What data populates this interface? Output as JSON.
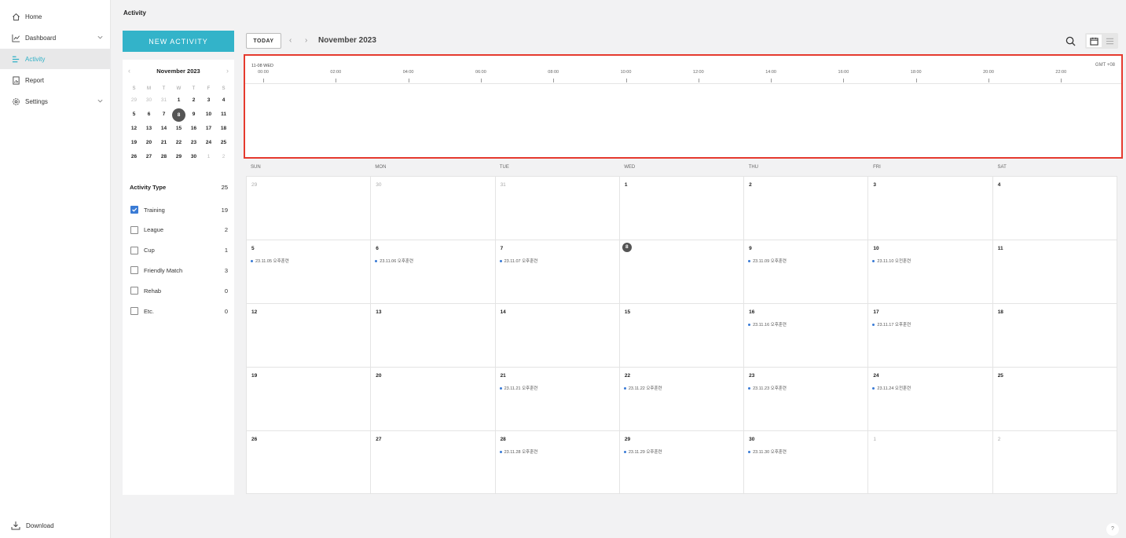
{
  "sidebar": {
    "items": [
      {
        "label": "Home"
      },
      {
        "label": "Dashboard"
      },
      {
        "label": "Activity"
      },
      {
        "label": "Report"
      },
      {
        "label": "Settings"
      }
    ],
    "download": "Download"
  },
  "header": {
    "title": "Activity"
  },
  "left_panel": {
    "new_button": "NEW ACTIVITY",
    "mini_calendar": {
      "title": "November 2023",
      "dow": [
        "S",
        "M",
        "T",
        "W",
        "T",
        "F",
        "S"
      ],
      "weeks": [
        [
          "29",
          "30",
          "31",
          "1",
          "2",
          "3",
          "4"
        ],
        [
          "5",
          "6",
          "7",
          "8",
          "9",
          "10",
          "11"
        ],
        [
          "12",
          "13",
          "14",
          "15",
          "16",
          "17",
          "18"
        ],
        [
          "19",
          "20",
          "21",
          "22",
          "23",
          "24",
          "25"
        ],
        [
          "26",
          "27",
          "28",
          "29",
          "30",
          "1",
          "2"
        ]
      ]
    },
    "activity_type": {
      "label": "Activity Type",
      "count": "25",
      "items": [
        {
          "label": "Training",
          "count": "19",
          "checked": true
        },
        {
          "label": "League",
          "count": "2",
          "checked": false
        },
        {
          "label": "Cup",
          "count": "1",
          "checked": false
        },
        {
          "label": "Friendly Match",
          "count": "3",
          "checked": false
        },
        {
          "label": "Rehab",
          "count": "0",
          "checked": false
        },
        {
          "label": "Etc.",
          "count": "0",
          "checked": false
        }
      ]
    }
  },
  "toolbar": {
    "today": "TODAY",
    "month_title": "November 2023"
  },
  "timeline": {
    "date_label": "11-08 WED",
    "timezone": "GMT +08",
    "hours": [
      "00:00",
      "02:00",
      "04:00",
      "06:00",
      "08:00",
      "10:00",
      "12:00",
      "14:00",
      "16:00",
      "18:00",
      "20:00",
      "22:00"
    ]
  },
  "month": {
    "dow": [
      "SUN",
      "MON",
      "TUE",
      "WED",
      "THU",
      "FRI",
      "SAT"
    ],
    "weeks": [
      [
        {
          "d": "29"
        },
        {
          "d": "30"
        },
        {
          "d": "31"
        },
        {
          "d": "1"
        },
        {
          "d": "2"
        },
        {
          "d": "3"
        },
        {
          "d": "4"
        }
      ],
      [
        {
          "d": "5",
          "e": "23.11.05 오후훈련"
        },
        {
          "d": "6",
          "e": "23.11.06 오후훈련"
        },
        {
          "d": "7",
          "e": "23.11.07 오후훈련"
        },
        {
          "d": "8"
        },
        {
          "d": "9",
          "e": "23.11.09 오후훈련"
        },
        {
          "d": "10",
          "e": "23.11.10 오전훈련"
        },
        {
          "d": "11"
        }
      ],
      [
        {
          "d": "12"
        },
        {
          "d": "13"
        },
        {
          "d": "14"
        },
        {
          "d": "15"
        },
        {
          "d": "16",
          "e": "23.11.16 오후훈련"
        },
        {
          "d": "17",
          "e": "23.11.17 오후훈련"
        },
        {
          "d": "18"
        }
      ],
      [
        {
          "d": "19"
        },
        {
          "d": "20"
        },
        {
          "d": "21",
          "e": "23.11.21 오후훈련"
        },
        {
          "d": "22",
          "e": "23.11.22 오후훈련"
        },
        {
          "d": "23",
          "e": "23.11.23 오후훈련"
        },
        {
          "d": "24",
          "e": "23.11.24 오전훈련"
        },
        {
          "d": "25"
        }
      ],
      [
        {
          "d": "26"
        },
        {
          "d": "27"
        },
        {
          "d": "28",
          "e": "23.11.28 오후훈련"
        },
        {
          "d": "29",
          "e": "23.11.29 오후훈련"
        },
        {
          "d": "30",
          "e": "23.11.30 오후훈련"
        },
        {
          "d": "1"
        },
        {
          "d": "2"
        }
      ]
    ]
  },
  "help": "?"
}
